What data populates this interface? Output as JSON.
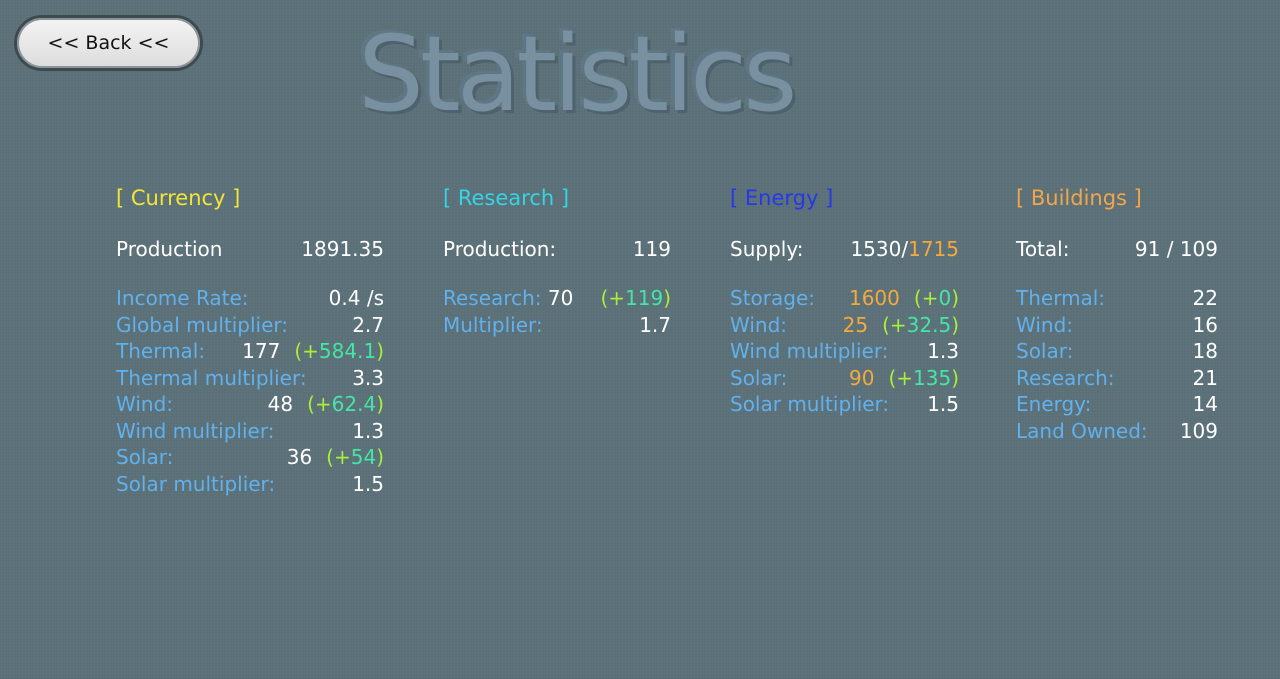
{
  "back_button": "<< Back <<",
  "title": "Statistics",
  "currency": {
    "header": "[ Currency ]",
    "production_label": "Production",
    "production_value": "1891.35",
    "rows": [
      {
        "label": "Income Rate:",
        "value": "0.4 /s"
      },
      {
        "label": "Global multiplier:",
        "value": "2.7"
      },
      {
        "label": "Thermal:",
        "value": "177",
        "bonus_open": "(+",
        "bonus": "584.1",
        "bonus_close": ")"
      },
      {
        "label": "Thermal multiplier:",
        "value": "3.3"
      },
      {
        "label": "Wind:",
        "value": "48",
        "bonus_open": "(+",
        "bonus": "62.4",
        "bonus_close": ")"
      },
      {
        "label": "Wind multiplier:",
        "value": "1.3"
      },
      {
        "label": "Solar:",
        "value": "36",
        "bonus_open": "(+",
        "bonus": "54",
        "bonus_close": ")"
      },
      {
        "label": "Solar multiplier:",
        "value": "1.5"
      }
    ]
  },
  "research": {
    "header": "[ Research ]",
    "production_label": "Production:",
    "production_value": "119",
    "rows": [
      {
        "label": "Research:",
        "value": "70",
        "bonus_open": "(+",
        "bonus": "119",
        "bonus_close": ")"
      },
      {
        "label": "Multiplier:",
        "value": "1.7"
      }
    ]
  },
  "energy": {
    "header": "[ Energy ]",
    "supply_label": "Supply:",
    "supply_current": "1530",
    "supply_sep": "/",
    "supply_max": "1715",
    "rows": [
      {
        "label": "Storage:",
        "value": "1600",
        "bonus_open": "(+",
        "bonus": "0",
        "bonus_close": ")"
      },
      {
        "label": "Wind:",
        "value": "25",
        "bonus_open": "(+",
        "bonus": "32.5",
        "bonus_close": ")"
      },
      {
        "label": "Wind multiplier:",
        "value": "1.3"
      },
      {
        "label": "Solar:",
        "value": "90",
        "bonus_open": "(+",
        "bonus": "135",
        "bonus_close": ")"
      },
      {
        "label": "Solar multiplier:",
        "value": "1.5"
      }
    ]
  },
  "buildings": {
    "header": "[ Buildings ]",
    "total_label": "Total:",
    "total_value": "91 / 109",
    "rows": [
      {
        "label": "Thermal:",
        "value": "22"
      },
      {
        "label": "Wind:",
        "value": "16"
      },
      {
        "label": "Solar:",
        "value": "18"
      },
      {
        "label": "Research:",
        "value": "21"
      },
      {
        "label": "Energy:",
        "value": "14"
      },
      {
        "label": "Land Owned:",
        "value": "109"
      }
    ]
  },
  "colors": {
    "background": "#5b6f78",
    "label": "#61b1ec",
    "currency_header": "#f2e535",
    "research_header": "#35d4e4",
    "energy_header": "#2538e8",
    "buildings_header": "#f2a64a",
    "bonus_paren": "#a8ef3c",
    "bonus_value": "#44e6a6",
    "energy_value": "#f4a93c"
  }
}
